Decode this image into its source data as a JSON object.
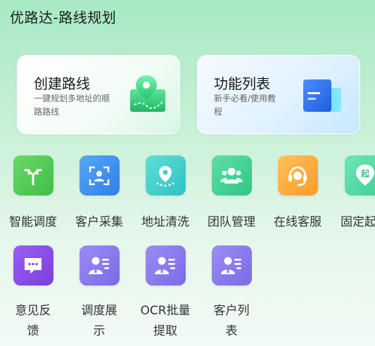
{
  "header": {
    "title": "优路达-路线规划"
  },
  "cards": [
    {
      "title": "创建路线",
      "subtitle": "一键规划多地址的顺路路线"
    },
    {
      "title": "功能列表",
      "subtitle": "新手必看/使用教程"
    }
  ],
  "grid": {
    "row1": [
      {
        "label": "智能调度",
        "icon": "route-split-icon",
        "color": "#4cc94c"
      },
      {
        "label": "客户采集",
        "icon": "contact-scan-icon",
        "color": "#3d8ef0"
      },
      {
        "label": "地址清洗",
        "icon": "location-pin-icon",
        "color": "#3fd2cc"
      },
      {
        "label": "团队管理",
        "icon": "team-icon",
        "color": "#3fd69a"
      },
      {
        "label": "在线客服",
        "icon": "headset-icon",
        "color": "#ffaa3a"
      },
      {
        "label": "固定起",
        "icon": "start-point-icon",
        "color": "#45d9a2"
      }
    ],
    "row2": [
      {
        "label": "意见反馈",
        "icon": "feedback-chat-icon",
        "color": "#8c4be6"
      },
      {
        "label": "调度展示",
        "icon": "user-card-icon",
        "color": "#8a7cf0"
      },
      {
        "label": "OCR批量提取",
        "icon": "user-card-icon",
        "color": "#8a7cf0"
      },
      {
        "label": "客户列表",
        "icon": "user-card-icon",
        "color": "#8a7cf0"
      }
    ]
  }
}
